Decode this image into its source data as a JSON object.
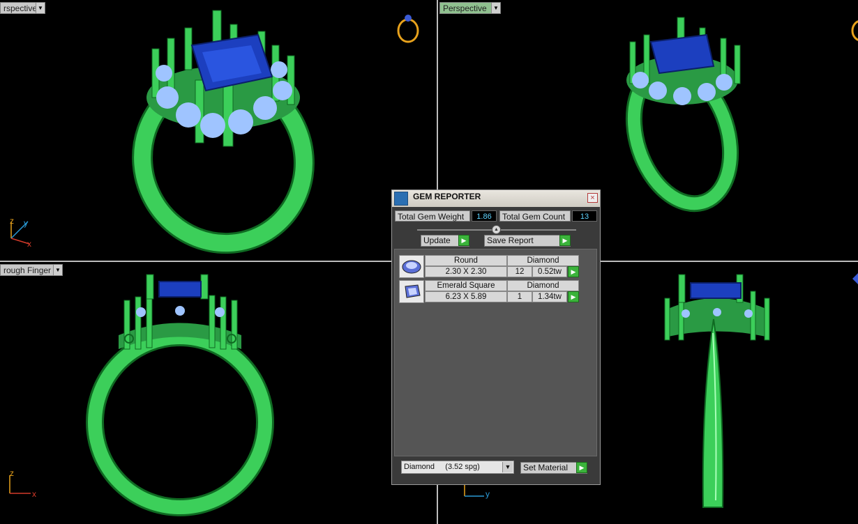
{
  "viewports": [
    {
      "id": "top-left",
      "label": "rspective",
      "label_bg": "#c8c8c8"
    },
    {
      "id": "top-right",
      "label": "Perspective",
      "label_bg": "#8fc08f"
    },
    {
      "id": "bottom-left",
      "label": "rough Finger",
      "label_bg": "#c8c8c8"
    },
    {
      "id": "bottom-right",
      "label": ""
    }
  ],
  "axes": {
    "z": "z",
    "y": "y",
    "x": "x"
  },
  "colors": {
    "metal": "#3ccf5a",
    "metal_dark": "#0f6a22",
    "center_stone": "#1c3fbf",
    "side_stone": "#9fc4ff",
    "gizmo": "#e8a21c"
  },
  "dialog": {
    "title": "GEM REPORTER",
    "close": "×",
    "total_weight_label": "Total Gem Weight",
    "total_weight_value": "1.86",
    "total_count_label": "Total Gem Count",
    "total_count_value": "13",
    "update_label": "Update",
    "save_label": "Save Report",
    "gems": [
      {
        "shape": "Round",
        "size": "2.30 X 2.30",
        "material": "Diamond",
        "count": "12",
        "weight": "0.52tw"
      },
      {
        "shape": "Emerald Square",
        "size": "6.23 X 5.89",
        "material": "Diamond",
        "count": "1",
        "weight": "1.34tw"
      }
    ],
    "material_select": "Diamond     (3.52 spg)",
    "set_material_label": "Set Material"
  }
}
